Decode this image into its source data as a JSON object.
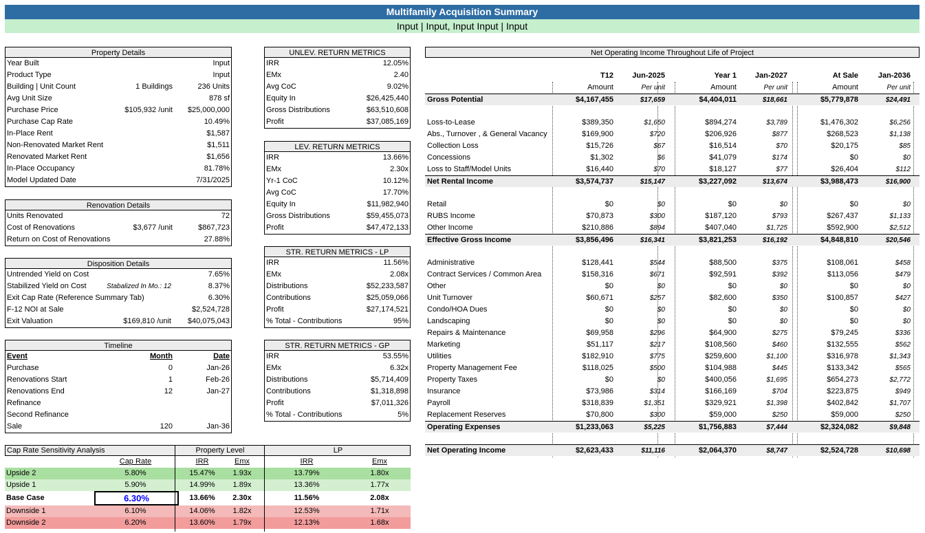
{
  "title": "Multifamily Acquisition Summary",
  "subtitle": "Input |  Input, Input Input  | Input",
  "property_details": {
    "header": "Property Details",
    "rows": [
      {
        "label": "Year Built",
        "mid": "",
        "value": "Input"
      },
      {
        "label": "Product Type",
        "mid": "",
        "value": "Input"
      },
      {
        "label": "Building  |  Unit Count",
        "mid": "1 Buildings",
        "value": "236 Units"
      },
      {
        "label": "Avg Unit Size",
        "mid": "",
        "value": "878 sf"
      },
      {
        "label": "Purchase Price",
        "mid": "$105,932 /unit",
        "value": "$25,000,000"
      },
      {
        "label": "Purchase Cap Rate",
        "mid": "",
        "value": "10.49%"
      },
      {
        "label": "In-Place Rent",
        "mid": "",
        "value": "$1,587"
      },
      {
        "label": "Non-Renovated Market Rent",
        "mid": "",
        "value": "$1,511"
      },
      {
        "label": "Renovated Market Rent",
        "mid": "",
        "value": "$1,656"
      },
      {
        "label": "In-Place Occupancy",
        "mid": "",
        "value": "81.78%"
      },
      {
        "label": "Model Updated Date",
        "mid": "",
        "value": "7/31/2025"
      }
    ]
  },
  "renovation_details": {
    "header": "Renovation Details",
    "rows": [
      {
        "label": "Units Renovated",
        "mid": "",
        "value": "72"
      },
      {
        "label": "Cost of Renovations",
        "mid": "$3,677 /unit",
        "value": "$867,723"
      },
      {
        "label": "Return on Cost of Renovations",
        "mid": "",
        "value": "27.88%"
      }
    ]
  },
  "disposition_details": {
    "header": "Disposition Details",
    "rows": [
      {
        "label": "Untrended Yield on Cost",
        "mid": "",
        "value": "7.65%"
      },
      {
        "label": "Stabilized Yield on Cost",
        "mid": "Stabalized In Mo.: 12",
        "value": "8.37%"
      },
      {
        "label": "Exit Cap Rate (Reference Summary Tab)",
        "mid": "",
        "value": "6.30%"
      },
      {
        "label": "F-12 NOI at Sale",
        "mid": "",
        "value": "$2,524,728"
      },
      {
        "label": "Exit Valuation",
        "mid": "$169,810 /unit",
        "value": "$40,075,043"
      }
    ]
  },
  "timeline": {
    "header": "Timeline",
    "columns": [
      "Event",
      "Month",
      "Date"
    ],
    "rows": [
      {
        "event": "Purchase",
        "month": "0",
        "date": "Jan-26"
      },
      {
        "event": "Renovations Start",
        "month": "1",
        "date": "Feb-26"
      },
      {
        "event": "Renovations End",
        "month": "12",
        "date": "Jan-27"
      },
      {
        "event": "Refinance",
        "month": "",
        "date": ""
      },
      {
        "event": "Second Refinance",
        "month": "",
        "date": ""
      },
      {
        "event": "Sale",
        "month": "120",
        "date": "Jan-36"
      }
    ]
  },
  "unlev": {
    "header": "UNLEV. RETURN METRICS",
    "rows": [
      {
        "label": "IRR",
        "value": "12.05%"
      },
      {
        "label": "EMx",
        "value": "2.40"
      },
      {
        "label": "Avg CoC",
        "value": "9.02%"
      },
      {
        "label": "Equity In",
        "value": "$26,425,440"
      },
      {
        "label": "Gross Distributions",
        "value": "$63,510,608"
      },
      {
        "label": "Profit",
        "value": "$37,085,169"
      }
    ]
  },
  "lev": {
    "header": "LEV. RETURN METRICS",
    "rows": [
      {
        "label": "IRR",
        "value": "13.66%"
      },
      {
        "label": "EMx",
        "value": "2.30x"
      },
      {
        "label": "Yr-1 CoC",
        "value": "10.12%"
      },
      {
        "label": "Avg CoC",
        "value": "17.70%"
      },
      {
        "label": "Equity In",
        "value": "$11,982,940"
      },
      {
        "label": "Gross Distributions",
        "value": "$59,455,073"
      },
      {
        "label": "Profit",
        "value": "$47,472,133"
      }
    ]
  },
  "str_lp": {
    "header": "STR. RETURN METRICS - LP",
    "rows": [
      {
        "label": "IRR",
        "value": "11.56%"
      },
      {
        "label": "EMx",
        "value": "2.08x"
      },
      {
        "label": "Distributions",
        "value": "$52,233,587"
      },
      {
        "label": "Contributions",
        "value": "$25,059,066"
      },
      {
        "label": "Profit",
        "value": "$27,174,521"
      },
      {
        "label": "% Total - Contributions",
        "value": "95%"
      }
    ]
  },
  "str_gp": {
    "header": "STR. RETURN METRICS - GP",
    "rows": [
      {
        "label": "IRR",
        "value": "53.55%"
      },
      {
        "label": "EMx",
        "value": "6.32x"
      },
      {
        "label": "Distributions",
        "value": "$5,714,409"
      },
      {
        "label": "Contributions",
        "value": "$1,318,898"
      },
      {
        "label": "Profit",
        "value": "$7,011,326"
      },
      {
        "label": "% Total - Contributions",
        "value": "5%"
      }
    ]
  },
  "noi": {
    "header": "Net Operating Income Throughout Life of Project",
    "periods": [
      "T12",
      "Jun-2025",
      "Year 1",
      "Jan-2027",
      "At Sale",
      "Jan-2036"
    ],
    "subheads": [
      "Amount",
      "Per unit",
      "Amount",
      "Per unit",
      "Amount",
      "Per unit"
    ],
    "rows": [
      {
        "label": "Gross Potential",
        "v": [
          "$4,167,455",
          "$17,659",
          "$4,404,011",
          "$18,661",
          "$5,779,878",
          "$24,491"
        ],
        "total": true
      },
      {
        "gap": true
      },
      {
        "label": "Loss-to-Lease",
        "v": [
          "$389,350",
          "$1,650",
          "$894,274",
          "$3,789",
          "$1,476,302",
          "$6,256"
        ]
      },
      {
        "label": "Abs., Turnover , & General Vacancy",
        "v": [
          "$169,900",
          "$720",
          "$206,926",
          "$877",
          "$268,523",
          "$1,138"
        ]
      },
      {
        "label": "Collection Loss",
        "v": [
          "$15,726",
          "$67",
          "$16,514",
          "$70",
          "$20,175",
          "$85"
        ]
      },
      {
        "label": "Concessions",
        "v": [
          "$1,302",
          "$6",
          "$41,079",
          "$174",
          "$0",
          "$0"
        ]
      },
      {
        "label": "Loss to Staff/Model Units",
        "v": [
          "$16,440",
          "$70",
          "$18,127",
          "$77",
          "$26,404",
          "$112"
        ]
      },
      {
        "label": "Net Rental Income",
        "v": [
          "$3,574,737",
          "$15,147",
          "$3,227,092",
          "$13,674",
          "$3,988,473",
          "$16,900"
        ],
        "total": true
      },
      {
        "gap": true
      },
      {
        "label": "Retail",
        "v": [
          "$0",
          "$0",
          "$0",
          "$0",
          "$0",
          "$0"
        ]
      },
      {
        "label": "RUBS Income",
        "v": [
          "$70,873",
          "$300",
          "$187,120",
          "$793",
          "$267,437",
          "$1,133"
        ]
      },
      {
        "label": "Other Income",
        "v": [
          "$210,886",
          "$894",
          "$407,040",
          "$1,725",
          "$592,900",
          "$2,512"
        ]
      },
      {
        "label": "Effective Gross Income",
        "v": [
          "$3,856,496",
          "$16,341",
          "$3,821,253",
          "$16,192",
          "$4,848,810",
          "$20,546"
        ],
        "total": true
      },
      {
        "gap": true
      },
      {
        "label": "Administrative",
        "v": [
          "$128,441",
          "$544",
          "$88,500",
          "$375",
          "$108,061",
          "$458"
        ]
      },
      {
        "label": "Contract Services / Common Area",
        "v": [
          "$158,316",
          "$671",
          "$92,591",
          "$392",
          "$113,056",
          "$479"
        ]
      },
      {
        "label": "Other",
        "v": [
          "$0",
          "$0",
          "$0",
          "$0",
          "$0",
          "$0"
        ]
      },
      {
        "label": "Unit Turnover",
        "v": [
          "$60,671",
          "$257",
          "$82,600",
          "$350",
          "$100,857",
          "$427"
        ]
      },
      {
        "label": "Condo/HOA Dues",
        "v": [
          "$0",
          "$0",
          "$0",
          "$0",
          "$0",
          "$0"
        ]
      },
      {
        "label": "Landscaping",
        "v": [
          "$0",
          "$0",
          "$0",
          "$0",
          "$0",
          "$0"
        ]
      },
      {
        "label": "Repairs & Maintenance",
        "v": [
          "$69,958",
          "$296",
          "$64,900",
          "$275",
          "$79,245",
          "$336"
        ]
      },
      {
        "label": "Marketing",
        "v": [
          "$51,117",
          "$217",
          "$108,560",
          "$460",
          "$132,555",
          "$562"
        ]
      },
      {
        "label": "Utilities",
        "v": [
          "$182,910",
          "$775",
          "$259,600",
          "$1,100",
          "$316,978",
          "$1,343"
        ]
      },
      {
        "label": "Property Management Fee",
        "v": [
          "$118,025",
          "$500",
          "$104,988",
          "$445",
          "$133,342",
          "$565"
        ]
      },
      {
        "label": "Property Taxes",
        "v": [
          "$0",
          "$0",
          "$400,056",
          "$1,695",
          "$654,273",
          "$2,772"
        ]
      },
      {
        "label": "Insurance",
        "v": [
          "$73,986",
          "$314",
          "$166,169",
          "$704",
          "$223,875",
          "$949"
        ]
      },
      {
        "label": "Payroll",
        "v": [
          "$318,839",
          "$1,351",
          "$329,921",
          "$1,398",
          "$402,842",
          "$1,707"
        ]
      },
      {
        "label": "Replacement Reserves",
        "v": [
          "$70,800",
          "$300",
          "$59,000",
          "$250",
          "$59,000",
          "$250"
        ]
      },
      {
        "label": "Operating Expenses",
        "v": [
          "$1,233,063",
          "$5,225",
          "$1,756,883",
          "$7,444",
          "$2,324,082",
          "$9,848"
        ],
        "total": true
      },
      {
        "gap": true
      },
      {
        "label": "Net Operating Income",
        "v": [
          "$2,623,433",
          "$11,116",
          "$2,064,370",
          "$8,747",
          "$2,524,728",
          "$10,698"
        ],
        "total": true
      }
    ]
  },
  "sensitivity": {
    "header": "Cap Rate Sensitivity Analysis",
    "group_property": "Property Level",
    "group_lp": "LP",
    "columns": [
      "Cap Rate",
      "IRR",
      "Emx",
      "IRR",
      "Emx"
    ],
    "rows": [
      {
        "label": "Upside 2",
        "cap": "5.80%",
        "pirr": "15.47%",
        "pemx": "1.93x",
        "lirr": "13.79%",
        "lemx": "1.80x",
        "tone": "g2"
      },
      {
        "label": "Upside 1",
        "cap": "5.90%",
        "pirr": "14.99%",
        "pemx": "1.89x",
        "lirr": "13.36%",
        "lemx": "1.77x",
        "tone": "g1"
      },
      {
        "label": "Base Case",
        "cap": "6.30%",
        "pirr": "13.66%",
        "pemx": "2.30x",
        "lirr": "11.56%",
        "lemx": "2.08x",
        "tone": "base"
      },
      {
        "label": "Downside 1",
        "cap": "6.10%",
        "pirr": "14.06%",
        "pemx": "1.82x",
        "lirr": "12.53%",
        "lemx": "1.71x",
        "tone": "r1"
      },
      {
        "label": "Downside 2",
        "cap": "6.20%",
        "pirr": "13.60%",
        "pemx": "1.79x",
        "lirr": "12.13%",
        "lemx": "1.68x",
        "tone": "r2"
      }
    ]
  },
  "colors": {
    "title_bg": "#2e6da4",
    "subtitle_bg": "#c6efce",
    "header_bg": "#ececec",
    "base_cap": "#0000ff"
  }
}
